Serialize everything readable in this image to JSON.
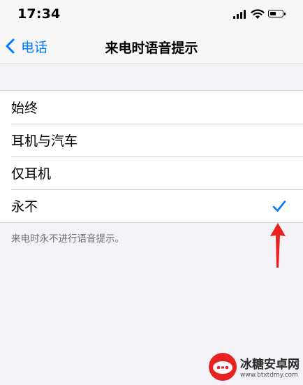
{
  "status_bar": {
    "time": "17:34",
    "battery_level": 0.55
  },
  "nav": {
    "back_label": "电话",
    "title": "来电时语音提示"
  },
  "options": [
    {
      "label": "始终",
      "selected": false
    },
    {
      "label": "耳机与汽车",
      "selected": false
    },
    {
      "label": "仅耳机",
      "selected": false
    },
    {
      "label": "永不",
      "selected": true
    }
  ],
  "footer_note": "来电时永不进行语音提示。",
  "colors": {
    "accent": "#007aff",
    "annotation": "#e8231f",
    "background": "#f2f2f7"
  },
  "watermark": {
    "text": "冰糖安卓网",
    "url": "www.btxtdmy.com"
  }
}
